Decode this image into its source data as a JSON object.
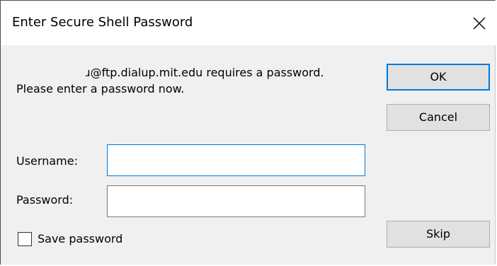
{
  "window": {
    "title": "Enter Secure Shell Password",
    "close_icon": "close-icon"
  },
  "message": {
    "line1": "ɹ@ftp.dialup.mit.edu requires a password.",
    "line2": "Please enter a password now."
  },
  "buttons": {
    "ok": "OK",
    "cancel": "Cancel",
    "skip": "Skip"
  },
  "fields": {
    "username_label": "Username:",
    "username_value": "",
    "password_label": "Password:",
    "password_value": ""
  },
  "save_password": {
    "label": "Save password",
    "checked": false
  },
  "colors": {
    "focus_accent": "#0078d7",
    "dialog_background": "#f0f0f0",
    "button_face": "#e1e1e1"
  }
}
